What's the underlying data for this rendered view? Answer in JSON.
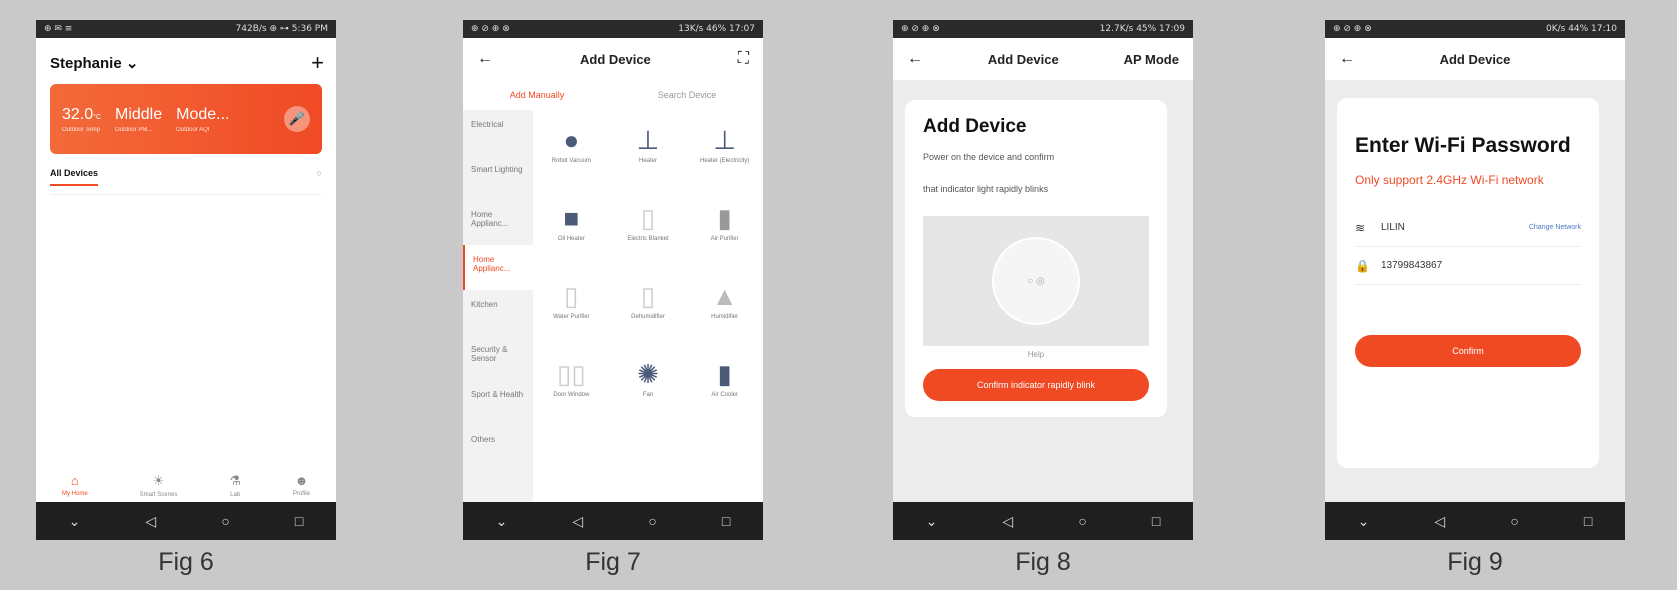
{
  "fig6": {
    "status_left": "⊕ ✉ ≡",
    "status_right": "742B/s ⊕ ⊶ 5:36 PM",
    "home_name": "Stephanie",
    "add_icon": "+",
    "stats": [
      {
        "value": "32.0",
        "unit": "°C",
        "label": "Outdoor Temp"
      },
      {
        "value": "Middle",
        "unit": "",
        "label": "Outdoor PM..."
      },
      {
        "value": "Mode...",
        "unit": "",
        "label": "Outdoor AQI"
      }
    ],
    "tab_all": "All Devices",
    "bottom_tabs": [
      "My Home",
      "Smart Scenes",
      "Lab",
      "Profile"
    ],
    "caption": "Fig 6"
  },
  "fig7": {
    "status_left": "⊕ ⊘ ⊕ ⊗",
    "status_right": "13K/s 46% 17:07",
    "title": "Add Device",
    "tabs": [
      "Add Manually",
      "Search Device"
    ],
    "categories": [
      "Electrical",
      "Smart Lighting",
      "Home Applianc...",
      "Home Applianc...",
      "Kitchen",
      "Security & Sensor",
      "Sport & Health",
      "Others"
    ],
    "devices": [
      "Robot Vacuum",
      "Heater",
      "Heater (Electricity)",
      "Oil Heater",
      "Electric Blanket",
      "Air Purifier",
      "Water Purifier",
      "Dehumidifier",
      "Humidifier",
      "Door Window",
      "Fan",
      "Air Cooler"
    ],
    "caption": "Fig  7"
  },
  "fig8": {
    "status_left": "⊕ ⊘ ⊕ ⊗",
    "status_right": "12.7K/s 45% 17:09",
    "title": "Add Device",
    "right_action": "AP Mode",
    "heading": "Add Device",
    "line1": "Power on the device and confirm",
    "line2": "that indicator light rapidly blinks",
    "help": "Help",
    "button": "Confirm indicator rapidly blink",
    "caption": "Fig 8"
  },
  "fig9": {
    "status_left": "⊕ ⊘ ⊕ ⊗",
    "status_right": "0K/s 44% 17:10",
    "title": "Add Device",
    "heading": "Enter Wi-Fi Password",
    "warning": "Only support 2.4GHz Wi-Fi network",
    "ssid": "LILIN",
    "change": "Change Network",
    "password": "13799843867",
    "button": "Confirm",
    "caption": "Fig 9"
  }
}
